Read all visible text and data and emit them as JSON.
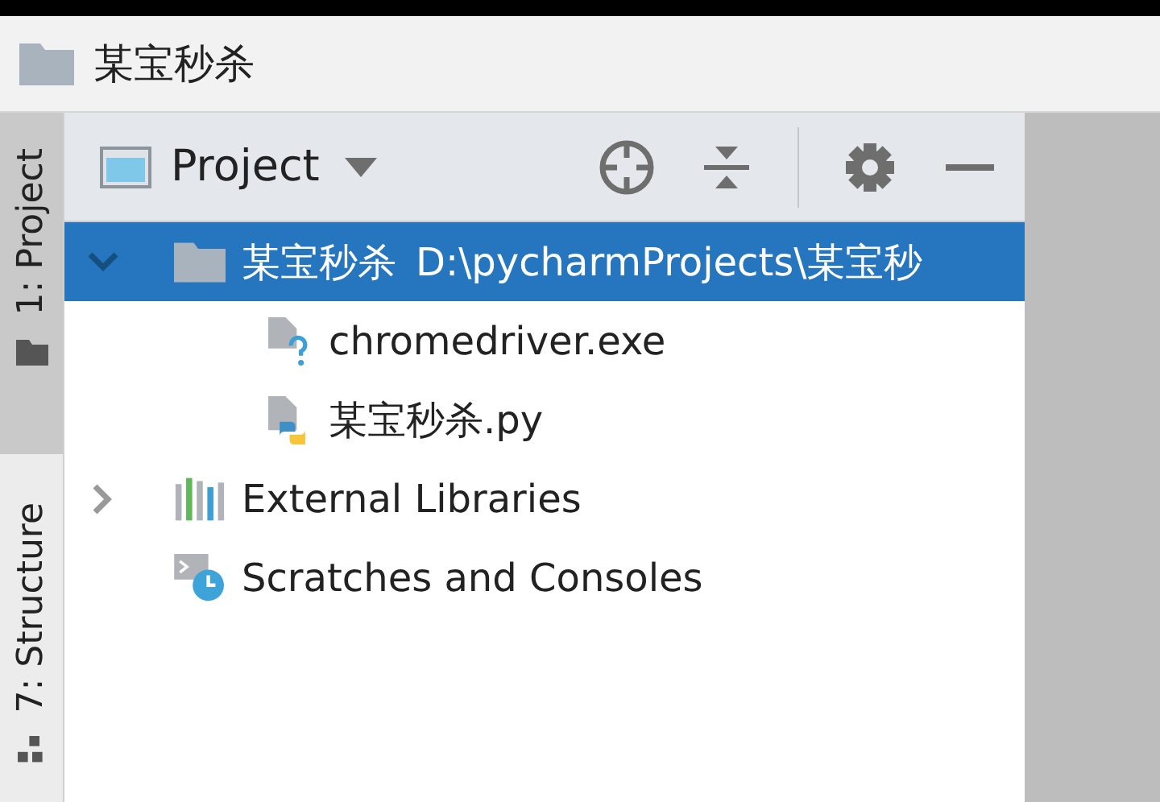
{
  "breadcrumb": {
    "label": "某宝秒杀"
  },
  "side_tabs": [
    {
      "label": "1: Project",
      "kind": "project",
      "selected": true
    },
    {
      "label": "7: Structure",
      "kind": "structure",
      "selected": false
    }
  ],
  "panel": {
    "view": "Project"
  },
  "tree": [
    {
      "label": "某宝秒杀",
      "path": "D:\\pycharmProjects\\某宝秒",
      "kind": "folder",
      "expanded": true,
      "selected": true,
      "children": [
        {
          "label": "chromedriver.exe",
          "kind": "unknown-file",
          "selected": false
        },
        {
          "label": "某宝秒杀.py",
          "kind": "python-file",
          "selected": false
        }
      ]
    },
    {
      "label": "External Libraries",
      "kind": "libraries",
      "expanded": false,
      "selected": false
    },
    {
      "label": "Scratches and Consoles",
      "kind": "scratches",
      "selected": false
    }
  ]
}
